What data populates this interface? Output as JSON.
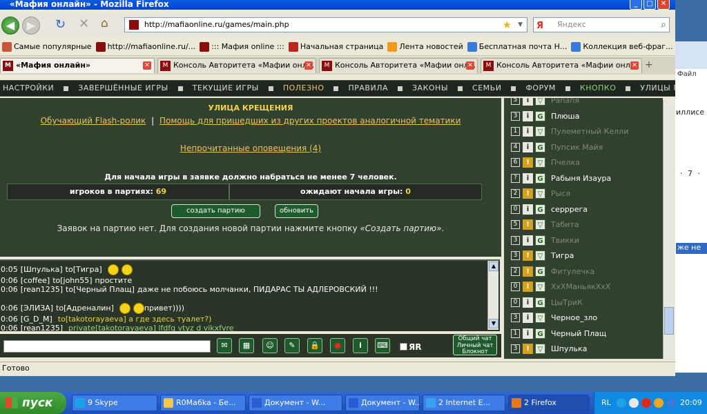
{
  "window": {
    "title": "«Мафия онлайн» - Mozilla Firefox",
    "minimize": "_",
    "maximize": "□",
    "close": "✕"
  },
  "navbar": {
    "url": "http://mafiaonline.ru/games/main.php",
    "search_placeholder": "Яндекс",
    "search_engine_label": "Я"
  },
  "bookmarks": [
    {
      "label": "Самые популярные",
      "color": "#c8563a"
    },
    {
      "label": "http://mafiaonline.ru/...",
      "color": "#8a0d0d"
    },
    {
      "label": "::: Мафия online :::",
      "color": "#8a0d0d"
    },
    {
      "label": "Начальная страница",
      "color": "#b8261e"
    },
    {
      "label": "Лента новостей",
      "color": "#f29a1e"
    },
    {
      "label": "Бесплатная почта Н...",
      "color": "#3a7ad8"
    },
    {
      "label": "Коллекция веб-фраг...",
      "color": "#3a7ad8"
    }
  ],
  "tabs": [
    {
      "label": "«Мафия онлайн»",
      "active": true
    },
    {
      "label": "Консоль Авторитета «Мафии онл..."
    },
    {
      "label": "Консоль Авторитета «Мафии онл..."
    },
    {
      "label": "Консоль Авторитета «Мафии онл..."
    }
  ],
  "new_tab_label": "+",
  "menu": [
    {
      "label": "НАСТРОЙКИ"
    },
    {
      "label": "ЗАВЕРШЁННЫЕ ИГРЫ"
    },
    {
      "label": "ТЕКУЩИЕ ИГРЫ"
    },
    {
      "label": "ПОЛЕЗНО",
      "style": "hl"
    },
    {
      "label": "ПРАВИЛА"
    },
    {
      "label": "ЗАКОНЫ"
    },
    {
      "label": "СЕМЬИ"
    },
    {
      "label": "ФОРУМ"
    },
    {
      "label": "КНОПКО",
      "style": "gr"
    },
    {
      "label": "УЛИЦЫ ГОРОДА"
    }
  ],
  "main": {
    "street_title": "УЛИЦА КРЕЩЕНИЯ",
    "link_flash": "Обучающий Flash-ролик",
    "link_sep": "|",
    "link_help": "Помощь для пришедших из других проектов аналогичной тематики",
    "notifications": "Непрочитанные оповещения (4)",
    "min_players_msg": "Для начала игры в заявке должно набраться не менее 7 человек.",
    "players_in_games_label": "игроков в партиях:",
    "players_in_games_value": "69",
    "waiting_label": "ожидают начала игры:",
    "waiting_value": "0",
    "create_button": "создать партию",
    "refresh_button": "обновить",
    "no_requests_prefix": "Заявок на партию нет. Для создания новой партии нажмите кнопку ",
    "no_requests_button_name": "«Создать партию»",
    "no_requests_suffix": "."
  },
  "chat": {
    "lines": [
      {
        "time": "0:05",
        "from": "[Шпулька]",
        "to": "to[Тигра]",
        "msg": "",
        "smileys": 2,
        "type": ""
      },
      {
        "time": "0:06",
        "from": "[coffee]",
        "to": "to[john55]",
        "msg": "простите",
        "smileys": 0,
        "type": ""
      },
      {
        "time": "0:06",
        "from": "[rean1235]",
        "to": "to[Черный Плащ]",
        "msg": "даже не побоюсь молчанки, ПИДАРАС ТЫ АДЛЕРОВСКИЙ !!!",
        "smileys": 0,
        "type": ""
      },
      {
        "time": "",
        "from": "",
        "to": "",
        "msg": "",
        "smileys": 0,
        "type": ""
      },
      {
        "time": "0:06",
        "from": "[ЭЛИЗА]",
        "to": "to[Адреналин]",
        "msg": "привет))))",
        "smileys": 2,
        "type": ""
      },
      {
        "time": "0:06",
        "from": "[G_D_M]",
        "to": "",
        "msg": "to[takotorayaeva] а где здесь туалет?)",
        "smileys": 0,
        "type": "pv"
      },
      {
        "time": "0:06",
        "from": "[rean1235]",
        "to": "",
        "msg": "private[takotorayaeva] lfdfq vtyz d vikxfvre",
        "smileys": 0,
        "type": "pv2"
      }
    ]
  },
  "chat_mode": {
    "line1": "Общий чат",
    "line2": "Личный чат",
    "line3": "Блокнот"
  },
  "filter_label": "ЯR",
  "players": [
    {
      "level": "5",
      "kind": "i",
      "name": "Рапапя",
      "online": false
    },
    {
      "level": "3",
      "kind": "i",
      "name": "Плюша",
      "online": true
    },
    {
      "level": "1",
      "kind": "i",
      "name": "Пулеметный Келли",
      "online": false
    },
    {
      "level": "4",
      "kind": "i",
      "name": "Пупсик Майя",
      "online": false
    },
    {
      "level": "6",
      "kind": "!",
      "name": "Пчелка",
      "online": false
    },
    {
      "level": "?",
      "kind": "i",
      "name": "Рабыня Изаура",
      "online": true
    },
    {
      "level": "2",
      "kind": "!",
      "name": "Рыся",
      "online": false
    },
    {
      "level": "0",
      "kind": "i",
      "name": "серррега",
      "online": true
    },
    {
      "level": "5",
      "kind": "!",
      "name": "Табита",
      "online": false
    },
    {
      "level": "3",
      "kind": "i",
      "name": "Твикки",
      "online": false
    },
    {
      "level": "3",
      "kind": "!",
      "name": "Тигра",
      "online": true
    },
    {
      "level": "2",
      "kind": "!",
      "name": "Фитулечка",
      "online": false
    },
    {
      "level": "0",
      "kind": "!",
      "name": "XxXМаньякXxX",
      "online": false
    },
    {
      "level": "0",
      "kind": "i",
      "name": "ЦыТриК",
      "online": false
    },
    {
      "level": "3",
      "kind": "i",
      "name": "Черное_зло",
      "online": true
    },
    {
      "level": "1",
      "kind": "i",
      "name": "Черный Плащ",
      "online": true
    },
    {
      "level": "3",
      "kind": "!",
      "name": "Шпулька",
      "online": true
    }
  ],
  "status_bar": "Готово",
  "taskbar": {
    "start_label": "пуск",
    "items": [
      {
        "label": "9 Skype",
        "color": "#1ea0e6"
      },
      {
        "label": "R0Ma6ka - Бе...",
        "color": "#f2c84a"
      },
      {
        "label": "Документ - W...",
        "color": "#2a5bd0"
      },
      {
        "label": "Документ - W...",
        "color": "#2a5bd0"
      },
      {
        "label": "2 Internet E...",
        "color": "#3aa0f0"
      },
      {
        "label": "2 Firefox",
        "color": "#e8781e"
      }
    ],
    "lang": "RL",
    "clock": "20:09"
  },
  "background_window": {
    "text1": "Файл",
    "text2": "иллисе",
    "text3": "же не",
    "text4": "· 7 ·"
  }
}
